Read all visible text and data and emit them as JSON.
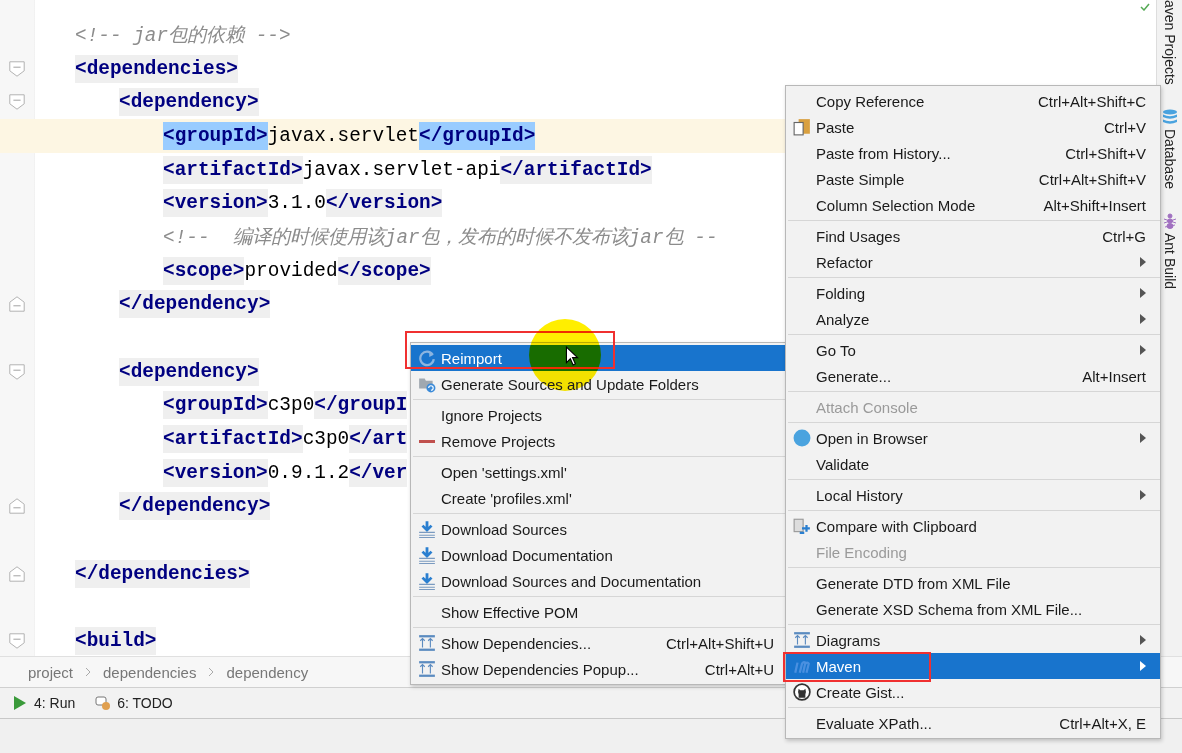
{
  "editor": {
    "lines": [
      {
        "kind": "plain",
        "current": false,
        "gap_before": false,
        "parts": [
          {
            "kind": "comment",
            "text": "<!-- jar包的依赖 -->"
          }
        ]
      },
      {
        "kind": "fold_start",
        "current": false,
        "gap_before": false,
        "parts": [
          {
            "kind": "tag",
            "text": "<dependencies>",
            "matched": false
          }
        ],
        "children": [
          {
            "kind": "fold_start",
            "current": false,
            "gap_before": false,
            "parts": [
              {
                "kind": "tag",
                "text": "<dependency>",
                "matched": false
              }
            ],
            "children": [
              {
                "kind": "plain",
                "current": true,
                "gap_before": false,
                "parts": [
                  {
                    "kind": "tag",
                    "text": "<groupId>",
                    "matched": true
                  },
                  {
                    "kind": "text",
                    "text": "javax.servlet"
                  },
                  {
                    "kind": "tag",
                    "text": "</groupId>",
                    "matched": true
                  }
                ]
              },
              {
                "kind": "plain",
                "current": false,
                "gap_before": false,
                "parts": [
                  {
                    "kind": "tag",
                    "text": "<artifactId>",
                    "matched": false
                  },
                  {
                    "kind": "text",
                    "text": "javax.servlet-api"
                  },
                  {
                    "kind": "tag",
                    "text": "</artifactId>",
                    "matched": false
                  }
                ]
              },
              {
                "kind": "plain",
                "current": false,
                "gap_before": false,
                "parts": [
                  {
                    "kind": "tag",
                    "text": "<version>",
                    "matched": false
                  },
                  {
                    "kind": "text",
                    "text": "3.1.0"
                  },
                  {
                    "kind": "tag",
                    "text": "</version>",
                    "matched": false
                  }
                ]
              },
              {
                "kind": "plain",
                "current": false,
                "gap_before": false,
                "parts": [
                  {
                    "kind": "comment",
                    "text": "<!--  编译的时候使用该jar包，发布的时候不发布该jar包 --"
                  }
                ]
              },
              {
                "kind": "plain",
                "current": false,
                "gap_before": false,
                "parts": [
                  {
                    "kind": "tag",
                    "text": "<scope>",
                    "matched": false
                  },
                  {
                    "kind": "text",
                    "text": "provided"
                  },
                  {
                    "kind": "tag",
                    "text": "</scope>",
                    "matched": false
                  }
                ]
              }
            ]
          },
          {
            "kind": "fold_end",
            "current": false,
            "gap_before": false,
            "parts": [
              {
                "kind": "tag",
                "text": "</dependency>",
                "matched": false
              }
            ]
          },
          {
            "kind": "fold_start",
            "current": false,
            "gap_before": true,
            "parts": [
              {
                "kind": "tag",
                "text": "<dependency>",
                "matched": false
              }
            ],
            "children": [
              {
                "kind": "plain",
                "current": false,
                "gap_before": false,
                "parts": [
                  {
                    "kind": "tag",
                    "text": "<groupId>",
                    "matched": false
                  },
                  {
                    "kind": "text",
                    "text": "c3p0"
                  },
                  {
                    "kind": "tag",
                    "text": "</groupI",
                    "matched": false
                  }
                ]
              },
              {
                "kind": "plain",
                "current": false,
                "gap_before": false,
                "parts": [
                  {
                    "kind": "tag",
                    "text": "<artifactId>",
                    "matched": false
                  },
                  {
                    "kind": "text",
                    "text": "c3p0"
                  },
                  {
                    "kind": "tag",
                    "text": "</art",
                    "matched": false
                  }
                ]
              },
              {
                "kind": "plain",
                "current": false,
                "gap_before": false,
                "parts": [
                  {
                    "kind": "tag",
                    "text": "<version>",
                    "matched": false
                  },
                  {
                    "kind": "text",
                    "text": "0.9.1.2"
                  },
                  {
                    "kind": "tag",
                    "text": "</ver",
                    "matched": false
                  }
                ]
              }
            ]
          },
          {
            "kind": "fold_end",
            "current": false,
            "gap_before": false,
            "parts": [
              {
                "kind": "tag",
                "text": "</dependency>",
                "matched": false
              }
            ]
          }
        ]
      },
      {
        "kind": "fold_end",
        "current": false,
        "gap_before": true,
        "parts": [
          {
            "kind": "tag",
            "text": "</dependencies>",
            "matched": false
          }
        ]
      },
      {
        "kind": "fold_start",
        "current": false,
        "gap_before": true,
        "parts": [
          {
            "kind": "tag",
            "text": "<build>",
            "matched": false
          }
        ]
      }
    ]
  },
  "breadcrumbs": [
    "project",
    "dependencies",
    "dependency"
  ],
  "tool_windows": [
    {
      "kind": "run",
      "label": "4: Run"
    },
    {
      "kind": "todo",
      "label": "6: TODO"
    }
  ],
  "side_tabs": [
    {
      "kind": "maven",
      "label": "aven Projects"
    },
    {
      "kind": "database",
      "label": "Database"
    },
    {
      "kind": "ant",
      "label": "Ant Build"
    }
  ],
  "context_menu": {
    "groups": [
      [
        {
          "kind": "plain",
          "label": "Copy Reference",
          "shortcut": "Ctrl+Alt+Shift+C",
          "submenu": false,
          "disabled": false,
          "selected": false,
          "annotated": false
        },
        {
          "kind": "paste",
          "label": "Paste",
          "shortcut": "Ctrl+V",
          "submenu": false,
          "disabled": false,
          "selected": false,
          "annotated": false
        },
        {
          "kind": "plain",
          "label": "Paste from History...",
          "shortcut": "Ctrl+Shift+V",
          "submenu": false,
          "disabled": false,
          "selected": false,
          "annotated": false
        },
        {
          "kind": "plain",
          "label": "Paste Simple",
          "shortcut": "Ctrl+Alt+Shift+V",
          "submenu": false,
          "disabled": false,
          "selected": false,
          "annotated": false
        },
        {
          "kind": "plain",
          "label": "Column Selection Mode",
          "shortcut": "Alt+Shift+Insert",
          "submenu": false,
          "disabled": false,
          "selected": false,
          "annotated": false
        }
      ],
      [
        {
          "kind": "plain",
          "label": "Find Usages",
          "shortcut": "Ctrl+G",
          "submenu": false,
          "disabled": false,
          "selected": false,
          "annotated": false
        },
        {
          "kind": "plain",
          "label": "Refactor",
          "submenu": true,
          "disabled": false,
          "selected": false,
          "annotated": false
        }
      ],
      [
        {
          "kind": "plain",
          "label": "Folding",
          "submenu": true,
          "disabled": false,
          "selected": false,
          "annotated": false
        },
        {
          "kind": "plain",
          "label": "Analyze",
          "submenu": true,
          "disabled": false,
          "selected": false,
          "annotated": false
        }
      ],
      [
        {
          "kind": "plain",
          "label": "Go To",
          "submenu": true,
          "disabled": false,
          "selected": false,
          "annotated": false
        },
        {
          "kind": "plain",
          "label": "Generate...",
          "shortcut": "Alt+Insert",
          "submenu": false,
          "disabled": false,
          "selected": false,
          "annotated": false
        }
      ],
      [
        {
          "kind": "plain",
          "label": "Attach Console",
          "submenu": false,
          "disabled": true,
          "selected": false,
          "annotated": false
        }
      ],
      [
        {
          "kind": "globe",
          "label": "Open in Browser",
          "submenu": true,
          "disabled": false,
          "selected": false,
          "annotated": false
        },
        {
          "kind": "plain",
          "label": "Validate",
          "submenu": false,
          "disabled": false,
          "selected": false,
          "annotated": false
        }
      ],
      [
        {
          "kind": "plain",
          "label": "Local History",
          "submenu": true,
          "disabled": false,
          "selected": false,
          "annotated": false
        }
      ],
      [
        {
          "kind": "compare",
          "label": "Compare with Clipboard",
          "submenu": false,
          "disabled": false,
          "selected": false,
          "annotated": false
        },
        {
          "kind": "plain",
          "label": "File Encoding",
          "submenu": false,
          "disabled": true,
          "selected": false,
          "annotated": false
        }
      ],
      [
        {
          "kind": "plain",
          "label": "Generate DTD from XML File",
          "submenu": false,
          "disabled": false,
          "selected": false,
          "annotated": false
        },
        {
          "kind": "plain",
          "label": "Generate XSD Schema from XML File...",
          "submenu": false,
          "disabled": false,
          "selected": false,
          "annotated": false
        }
      ],
      [
        {
          "kind": "diagram",
          "label": "Diagrams",
          "submenu": true,
          "disabled": false,
          "selected": false,
          "annotated": false
        },
        {
          "kind": "maven",
          "label": "Maven",
          "submenu": true,
          "disabled": false,
          "selected": true,
          "annotated": true
        },
        {
          "kind": "gist",
          "label": "Create Gist...",
          "submenu": false,
          "disabled": false,
          "selected": false,
          "annotated": false
        }
      ],
      [
        {
          "kind": "plain",
          "label": "Evaluate XPath...",
          "shortcut": "Ctrl+Alt+X, E",
          "submenu": false,
          "disabled": false,
          "selected": false,
          "annotated": false
        }
      ]
    ]
  },
  "maven_submenu": {
    "groups": [
      [
        {
          "kind": "reimport",
          "label": "Reimport",
          "submenu": false,
          "disabled": false,
          "selected": true,
          "annotated": true
        },
        {
          "kind": "sources",
          "label": "Generate Sources and Update Folders",
          "submenu": false,
          "disabled": false,
          "selected": false,
          "annotated": false
        }
      ],
      [
        {
          "kind": "plain",
          "label": "Ignore Projects",
          "submenu": false,
          "disabled": false,
          "selected": false,
          "annotated": false
        },
        {
          "kind": "remove",
          "label": "Remove Projects",
          "submenu": false,
          "disabled": false,
          "selected": false,
          "annotated": false
        }
      ],
      [
        {
          "kind": "plain",
          "label": "Open 'settings.xml'",
          "submenu": false,
          "disabled": false,
          "selected": false,
          "annotated": false
        },
        {
          "kind": "plain",
          "label": "Create 'profiles.xml'",
          "submenu": false,
          "disabled": false,
          "selected": false,
          "annotated": false
        }
      ],
      [
        {
          "kind": "download",
          "label": "Download Sources",
          "submenu": false,
          "disabled": false,
          "selected": false,
          "annotated": false
        },
        {
          "kind": "download",
          "label": "Download Documentation",
          "submenu": false,
          "disabled": false,
          "selected": false,
          "annotated": false
        },
        {
          "kind": "download",
          "label": "Download Sources and Documentation",
          "submenu": false,
          "disabled": false,
          "selected": false,
          "annotated": false
        }
      ],
      [
        {
          "kind": "plain",
          "label": "Show Effective POM",
          "submenu": false,
          "disabled": false,
          "selected": false,
          "annotated": false
        }
      ],
      [
        {
          "kind": "diagram",
          "label": "Show Dependencies...",
          "shortcut": "Ctrl+Alt+Shift+U",
          "submenu": false,
          "disabled": false,
          "selected": false,
          "annotated": false
        },
        {
          "kind": "diagram",
          "label": "Show Dependencies Popup...",
          "shortcut": "Ctrl+Alt+U",
          "submenu": false,
          "disabled": false,
          "selected": false,
          "annotated": false
        }
      ]
    ]
  }
}
